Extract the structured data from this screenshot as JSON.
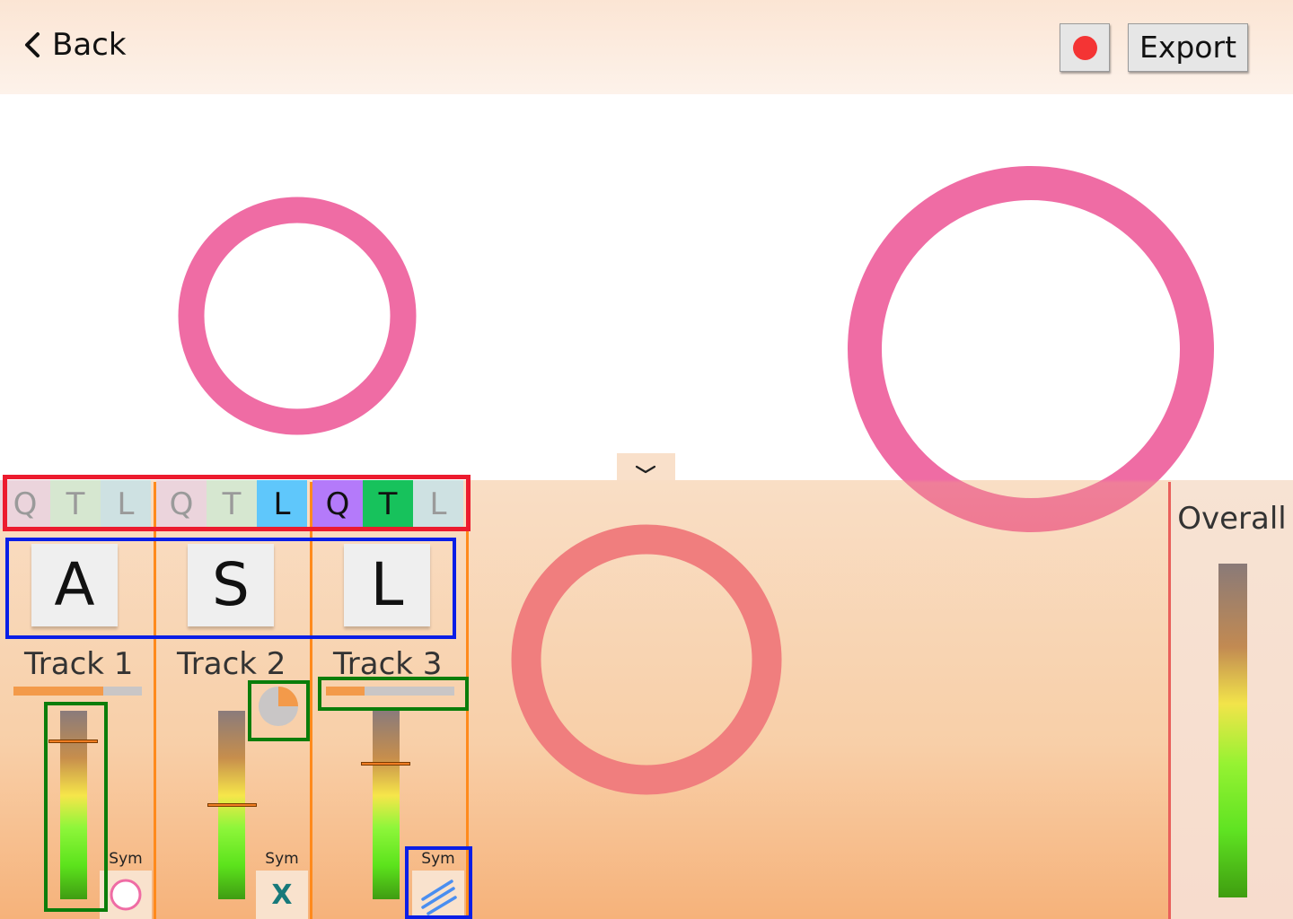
{
  "header": {
    "back_label": "Back",
    "export_label": "Export"
  },
  "tracks": [
    {
      "name": "Track 1",
      "key": "A",
      "tabs": [
        {
          "label": "Q",
          "active": false,
          "color": "#ebd4dc"
        },
        {
          "label": "T",
          "active": false,
          "color": "#d6e7d0"
        },
        {
          "label": "L",
          "active": false,
          "color": "#cee1e2"
        }
      ],
      "progress": 0.7,
      "level": 0.84,
      "sym_label": "Sym",
      "sym_icon": "ring-icon"
    },
    {
      "name": "Track 2",
      "key": "S",
      "tabs": [
        {
          "label": "Q",
          "active": false,
          "color": "#ebd4dc"
        },
        {
          "label": "T",
          "active": false,
          "color": "#d6e7d0"
        },
        {
          "label": "L",
          "active": true,
          "color": "#5fc7fb"
        }
      ],
      "progress_icon": "pie-progress-icon",
      "progress": 0.25,
      "level": 0.5,
      "sym_label": "Sym",
      "sym_icon": "x-icon",
      "sym_glyph": "X"
    },
    {
      "name": "Track 3",
      "key": "L",
      "tabs": [
        {
          "label": "Q",
          "active": true,
          "color": "#b47afa"
        },
        {
          "label": "T",
          "active": true,
          "color": "#17c25c"
        },
        {
          "label": "L",
          "active": false,
          "color": "#cee1e2"
        }
      ],
      "progress": 0.3,
      "level": 0.72,
      "sym_label": "Sym",
      "sym_icon": "diagonal-lines-icon"
    }
  ],
  "overall": {
    "label": "Overall"
  },
  "colors": {
    "ring": "#ef6ca4",
    "ring_lower": "#f07e7e",
    "record": "#f43434",
    "accent_orange": "#ff8a1c",
    "annotation_red": "#ec1b2e",
    "annotation_blue": "#0a1ee6",
    "annotation_green": "#0a7d0a"
  }
}
